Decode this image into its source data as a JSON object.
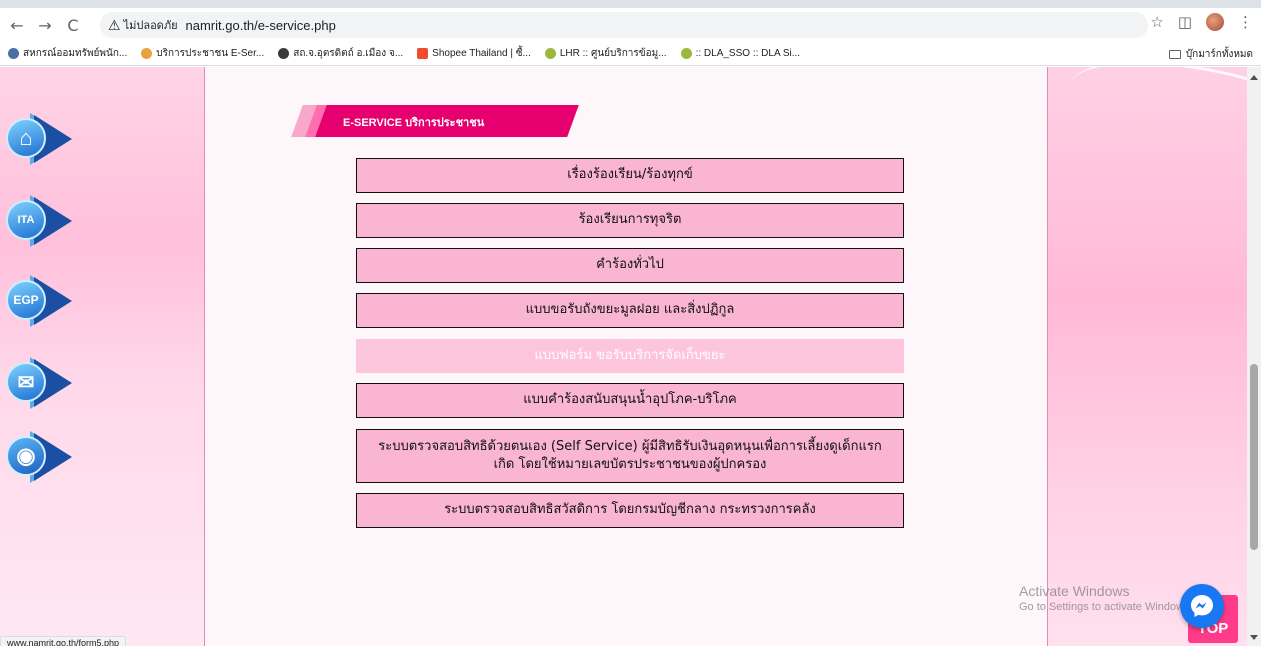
{
  "browser": {
    "security_label": "ไม่ปลอดภัย",
    "url": "namrit.go.th/e-service.php",
    "nav": {
      "back": "←",
      "forward": "→",
      "reload": "C"
    },
    "right_icons": {
      "star": "☆",
      "sidepanel": "◫",
      "menu": "⋮"
    }
  },
  "bookmarks": {
    "items": [
      {
        "label": "สหกรณ์ออมทรัพย์พนัก...",
        "color": "#4a6fa5"
      },
      {
        "label": "บริการประชาชน E-Ser...",
        "color": "#e8a33b"
      },
      {
        "label": "สถ.จ.อุตรดิตถ์ อ.เมือง จ...",
        "color": "#3b3b3b"
      },
      {
        "label": "Shopee Thailand | ซื้...",
        "color": "#ee4d2d"
      },
      {
        "label": "LHR :: ศูนย์บริการข้อมู...",
        "color": "#9bb83a"
      },
      {
        "label": ":: DLA_SSO :: DLA Si...",
        "color": "#9bb83a"
      }
    ],
    "all_bookmarks": "บุ๊กมาร์กทั้งหมด"
  },
  "section": {
    "title": "E-SERVICE บริการประชาชน"
  },
  "services": [
    {
      "label": "เรื่องร้องเรียน/ร้องทุกข์",
      "active": false
    },
    {
      "label": "ร้องเรียนการทุจริต",
      "active": false
    },
    {
      "label": "คำร้องทั่วไป",
      "active": false
    },
    {
      "label": "แบบขอรับถังขยะมูลฝอย และสิ่งปฏิกูล",
      "active": false
    },
    {
      "label": "แบบฟอร์ม ขอรับบริการจัดเก็บขยะ",
      "active": true
    },
    {
      "label": "แบบคำร้องสนับสนุนน้ำอุปโภค-บริโภค",
      "active": false
    },
    {
      "label": "ระบบตรวจสอบสิทธิด้วยตนเอง (Self Service) ผู้มีสิทธิรับเงินอุดหนุนเพื่อการเลี้ยงดูเด็กแรกเกิด โดยใช้หมายเลขบัตรประชาชนของผู้ปกครอง",
      "active": false
    },
    {
      "label": "ระบบตรวจสอบสิทธิสวัสดิการ โดยกรมบัญชีกลาง กระทรวงการคลัง",
      "active": false
    }
  ],
  "side_icons": [
    {
      "name": "home-icon",
      "text": "⌂"
    },
    {
      "name": "itax-icon",
      "text": "ITA"
    },
    {
      "name": "egp-icon",
      "text": "EGP"
    },
    {
      "name": "mail-icon",
      "text": "✉"
    },
    {
      "name": "user-icon",
      "text": "◉"
    }
  ],
  "status_url": "www.namrit.go.th/form5.php",
  "watermark": {
    "line1": "Activate Windows",
    "line2": "Go to Settings to activate Windows."
  },
  "top_button": "TOP"
}
